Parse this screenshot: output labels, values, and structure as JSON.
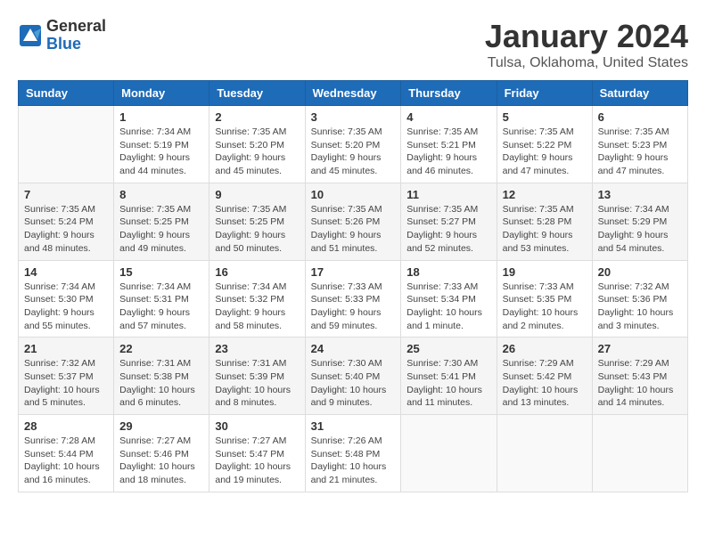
{
  "logo": {
    "general": "General",
    "blue": "Blue"
  },
  "header": {
    "month": "January 2024",
    "location": "Tulsa, Oklahoma, United States"
  },
  "weekdays": [
    "Sunday",
    "Monday",
    "Tuesday",
    "Wednesday",
    "Thursday",
    "Friday",
    "Saturday"
  ],
  "weeks": [
    [
      {
        "day": "",
        "sunrise": "",
        "sunset": "",
        "daylight": ""
      },
      {
        "day": "1",
        "sunrise": "Sunrise: 7:34 AM",
        "sunset": "Sunset: 5:19 PM",
        "daylight": "Daylight: 9 hours and 44 minutes."
      },
      {
        "day": "2",
        "sunrise": "Sunrise: 7:35 AM",
        "sunset": "Sunset: 5:20 PM",
        "daylight": "Daylight: 9 hours and 45 minutes."
      },
      {
        "day": "3",
        "sunrise": "Sunrise: 7:35 AM",
        "sunset": "Sunset: 5:20 PM",
        "daylight": "Daylight: 9 hours and 45 minutes."
      },
      {
        "day": "4",
        "sunrise": "Sunrise: 7:35 AM",
        "sunset": "Sunset: 5:21 PM",
        "daylight": "Daylight: 9 hours and 46 minutes."
      },
      {
        "day": "5",
        "sunrise": "Sunrise: 7:35 AM",
        "sunset": "Sunset: 5:22 PM",
        "daylight": "Daylight: 9 hours and 47 minutes."
      },
      {
        "day": "6",
        "sunrise": "Sunrise: 7:35 AM",
        "sunset": "Sunset: 5:23 PM",
        "daylight": "Daylight: 9 hours and 47 minutes."
      }
    ],
    [
      {
        "day": "7",
        "sunrise": "Sunrise: 7:35 AM",
        "sunset": "Sunset: 5:24 PM",
        "daylight": "Daylight: 9 hours and 48 minutes."
      },
      {
        "day": "8",
        "sunrise": "Sunrise: 7:35 AM",
        "sunset": "Sunset: 5:25 PM",
        "daylight": "Daylight: 9 hours and 49 minutes."
      },
      {
        "day": "9",
        "sunrise": "Sunrise: 7:35 AM",
        "sunset": "Sunset: 5:25 PM",
        "daylight": "Daylight: 9 hours and 50 minutes."
      },
      {
        "day": "10",
        "sunrise": "Sunrise: 7:35 AM",
        "sunset": "Sunset: 5:26 PM",
        "daylight": "Daylight: 9 hours and 51 minutes."
      },
      {
        "day": "11",
        "sunrise": "Sunrise: 7:35 AM",
        "sunset": "Sunset: 5:27 PM",
        "daylight": "Daylight: 9 hours and 52 minutes."
      },
      {
        "day": "12",
        "sunrise": "Sunrise: 7:35 AM",
        "sunset": "Sunset: 5:28 PM",
        "daylight": "Daylight: 9 hours and 53 minutes."
      },
      {
        "day": "13",
        "sunrise": "Sunrise: 7:34 AM",
        "sunset": "Sunset: 5:29 PM",
        "daylight": "Daylight: 9 hours and 54 minutes."
      }
    ],
    [
      {
        "day": "14",
        "sunrise": "Sunrise: 7:34 AM",
        "sunset": "Sunset: 5:30 PM",
        "daylight": "Daylight: 9 hours and 55 minutes."
      },
      {
        "day": "15",
        "sunrise": "Sunrise: 7:34 AM",
        "sunset": "Sunset: 5:31 PM",
        "daylight": "Daylight: 9 hours and 57 minutes."
      },
      {
        "day": "16",
        "sunrise": "Sunrise: 7:34 AM",
        "sunset": "Sunset: 5:32 PM",
        "daylight": "Daylight: 9 hours and 58 minutes."
      },
      {
        "day": "17",
        "sunrise": "Sunrise: 7:33 AM",
        "sunset": "Sunset: 5:33 PM",
        "daylight": "Daylight: 9 hours and 59 minutes."
      },
      {
        "day": "18",
        "sunrise": "Sunrise: 7:33 AM",
        "sunset": "Sunset: 5:34 PM",
        "daylight": "Daylight: 10 hours and 1 minute."
      },
      {
        "day": "19",
        "sunrise": "Sunrise: 7:33 AM",
        "sunset": "Sunset: 5:35 PM",
        "daylight": "Daylight: 10 hours and 2 minutes."
      },
      {
        "day": "20",
        "sunrise": "Sunrise: 7:32 AM",
        "sunset": "Sunset: 5:36 PM",
        "daylight": "Daylight: 10 hours and 3 minutes."
      }
    ],
    [
      {
        "day": "21",
        "sunrise": "Sunrise: 7:32 AM",
        "sunset": "Sunset: 5:37 PM",
        "daylight": "Daylight: 10 hours and 5 minutes."
      },
      {
        "day": "22",
        "sunrise": "Sunrise: 7:31 AM",
        "sunset": "Sunset: 5:38 PM",
        "daylight": "Daylight: 10 hours and 6 minutes."
      },
      {
        "day": "23",
        "sunrise": "Sunrise: 7:31 AM",
        "sunset": "Sunset: 5:39 PM",
        "daylight": "Daylight: 10 hours and 8 minutes."
      },
      {
        "day": "24",
        "sunrise": "Sunrise: 7:30 AM",
        "sunset": "Sunset: 5:40 PM",
        "daylight": "Daylight: 10 hours and 9 minutes."
      },
      {
        "day": "25",
        "sunrise": "Sunrise: 7:30 AM",
        "sunset": "Sunset: 5:41 PM",
        "daylight": "Daylight: 10 hours and 11 minutes."
      },
      {
        "day": "26",
        "sunrise": "Sunrise: 7:29 AM",
        "sunset": "Sunset: 5:42 PM",
        "daylight": "Daylight: 10 hours and 13 minutes."
      },
      {
        "day": "27",
        "sunrise": "Sunrise: 7:29 AM",
        "sunset": "Sunset: 5:43 PM",
        "daylight": "Daylight: 10 hours and 14 minutes."
      }
    ],
    [
      {
        "day": "28",
        "sunrise": "Sunrise: 7:28 AM",
        "sunset": "Sunset: 5:44 PM",
        "daylight": "Daylight: 10 hours and 16 minutes."
      },
      {
        "day": "29",
        "sunrise": "Sunrise: 7:27 AM",
        "sunset": "Sunset: 5:46 PM",
        "daylight": "Daylight: 10 hours and 18 minutes."
      },
      {
        "day": "30",
        "sunrise": "Sunrise: 7:27 AM",
        "sunset": "Sunset: 5:47 PM",
        "daylight": "Daylight: 10 hours and 19 minutes."
      },
      {
        "day": "31",
        "sunrise": "Sunrise: 7:26 AM",
        "sunset": "Sunset: 5:48 PM",
        "daylight": "Daylight: 10 hours and 21 minutes."
      },
      {
        "day": "",
        "sunrise": "",
        "sunset": "",
        "daylight": ""
      },
      {
        "day": "",
        "sunrise": "",
        "sunset": "",
        "daylight": ""
      },
      {
        "day": "",
        "sunrise": "",
        "sunset": "",
        "daylight": ""
      }
    ]
  ]
}
